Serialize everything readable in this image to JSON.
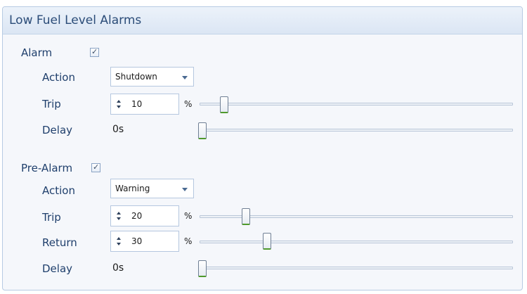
{
  "panel": {
    "title": "Low Fuel Level Alarms"
  },
  "alarm": {
    "label": "Alarm",
    "checked": true,
    "check_glyph": "✓",
    "action_label": "Action",
    "action_value": "Shutdown",
    "trip_label": "Trip",
    "trip_value": "10",
    "trip_unit": "%",
    "trip_slider_percent": 10,
    "delay_label": "Delay",
    "delay_value": "0s",
    "delay_slider_fraction": 0
  },
  "prealarm": {
    "label": "Pre-Alarm",
    "checked": true,
    "check_glyph": "✓",
    "action_label": "Action",
    "action_value": "Warning",
    "trip_label": "Trip",
    "trip_value": "20",
    "trip_unit": "%",
    "trip_slider_percent": 20,
    "return_label": "Return",
    "return_value": "30",
    "return_unit": "%",
    "return_slider_percent": 30,
    "delay_label": "Delay",
    "delay_value": "0s",
    "delay_slider_fraction": 0
  },
  "colors": {
    "label_text": "#1f3f6c",
    "title_text": "#2b4c78",
    "header_bg": "#dbe6f4",
    "panel_border": "#b7cbe3",
    "thumb_accent": "#4f9a2c"
  },
  "icons": {
    "checkbox": "checkbox-checked-icon",
    "dropdown": "chevron-down-icon",
    "spinner_up": "spin-up-icon",
    "spinner_down": "spin-down-icon"
  }
}
